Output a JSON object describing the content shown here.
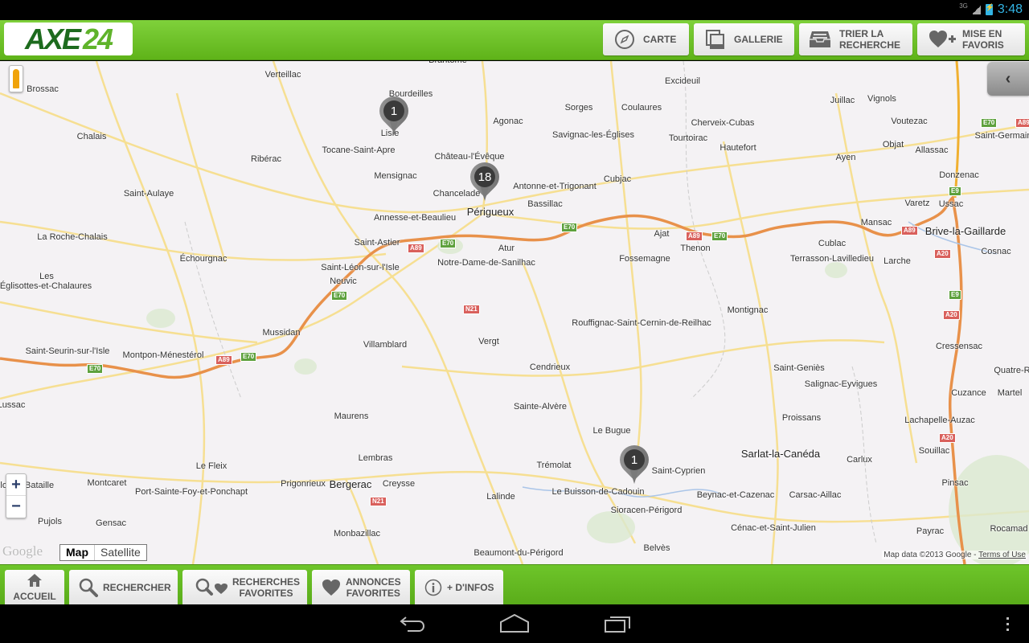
{
  "status_bar": {
    "network": "3G",
    "time": "3:48"
  },
  "app": {
    "logo_part1": "AXE",
    "logo_part2": "24"
  },
  "toolbar": {
    "buttons": [
      {
        "label": "CARTE",
        "icon": "compass-icon"
      },
      {
        "label": "GALLERIE",
        "icon": "gallery-icon"
      },
      {
        "label": "TRIER LA\nRECHERCHE",
        "icon": "inbox-tray-icon"
      },
      {
        "label": "MISE EN\nFAVORIS",
        "icon": "heart-plus-icon"
      }
    ]
  },
  "map": {
    "markers": [
      {
        "count": "1",
        "near": "Lisle"
      },
      {
        "count": "18",
        "near": "Périgueux"
      },
      {
        "count": "1",
        "near": "Le Buisson-de-Cadouin"
      }
    ],
    "places": [
      "Brantôme",
      "Verteillac",
      "Brossac",
      "Bourdeilles",
      "Excideuil",
      "Juillac",
      "Vignols",
      "Chalais",
      "Lisle",
      "Agonac",
      "Sorges",
      "Coulaures",
      "Cherveix-Cubas",
      "Voutezac",
      "Saint-Germain",
      "Tocane-Saint-Apre",
      "Château-l'Évêque",
      "Savignac-les-Églises",
      "Tourtoirac",
      "Hautefort",
      "Objat",
      "Allassac",
      "Ribérac",
      "Mensignac",
      "Cubjac",
      "Ayen",
      "Donzenac",
      "Saint-Aulaye",
      "Chancelade",
      "Antonne-et-Trigonant",
      "Bassillac",
      "Périgueux",
      "Varetz",
      "Ussac",
      "Annesse-et-Beaulieu",
      "Mansac",
      "Brive-la-Gaillarde",
      "La Roche-Chalais",
      "Ajat",
      "Saint-Astier",
      "Atur",
      "Thenon",
      "Cublac",
      "Échourgnac",
      "Fossemagne",
      "Terrasson-Lavilledieu",
      "Larche",
      "Cosnac",
      "Saint-Léon-sur-l'Isle",
      "Notre-Dame-de-Sanilhac",
      "Les",
      "Neuvic",
      "Églisottes-et-Chalaures",
      "Montignac",
      "Rouffignac-Saint-Cernin-de-Reilhac",
      "Mussidan",
      "Vergt",
      "Saint-Seurin-sur-l'Isle",
      "Montpon-Ménestérol",
      "Villamblard",
      "Cressensac",
      "Saint-Geniès",
      "Quatre-Ro",
      "Cendrieux",
      "Cuzance",
      "Salignac-Eyvigues",
      "Lussac",
      "Sainte-Alvère",
      "Martel",
      "Maurens",
      "Proissans",
      "Lachapelle-Auzac",
      "Le Bugue",
      "Lembras",
      "Sarlat-la-Canéda",
      "Souillac",
      "Le Fleix",
      "Trémolat",
      "Saint-Cyprien",
      "Carlux",
      "Montcaret",
      "Prigonrieux",
      "Bergerac",
      "Creysse",
      "Port-Sainte-Foy-et-Ponchapt",
      "Lalinde",
      "Le Buisson-de-Cadouin",
      "Beynac-et-Cazenac",
      "Carsac-Aillac",
      "Pinsac",
      "Sioracen-Périgord",
      "Pujols",
      "Gensac",
      "Cénac-et-Saint-Julien",
      "Payrac",
      "Rocamad",
      "Monbazillac",
      "Beaumont-du-Périgord",
      "Belvès",
      "Castillon-la-Bataille"
    ],
    "road_shields": [
      "E70",
      "A89",
      "N21",
      "A20",
      "E9"
    ],
    "zoom_in": "+",
    "zoom_out": "−",
    "map_type": {
      "options": [
        "Map",
        "Satellite"
      ],
      "selected": "Map"
    },
    "google_logo": "Google",
    "attribution": "Map data ©2013 Google - ",
    "terms_link": "Terms of Use"
  },
  "bottom_bar": {
    "buttons": [
      {
        "label": "ACCUEIL",
        "icon": "home-icon"
      },
      {
        "label": "RECHERCHER",
        "icon": "search-icon"
      },
      {
        "label": "RECHERCHES\nFAVORITES",
        "icon": "search-heart-icon"
      },
      {
        "label": "ANNONCES\nFAVORITES",
        "icon": "heart-icon"
      },
      {
        "label": "+ D'INFOS",
        "icon": "info-icon"
      }
    ]
  },
  "colors": {
    "brand_green": "#6ec52a",
    "logo_dark_green": "#1d6b1e",
    "highway": "#e8914a"
  }
}
